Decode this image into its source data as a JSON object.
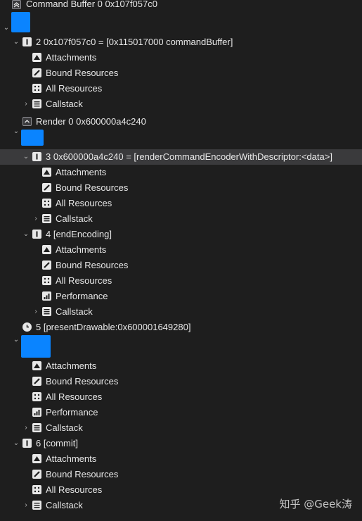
{
  "tree": {
    "command_buffer": "Command Buffer 0 0x107f057c0",
    "cmd2": "2 0x107f057c0 = [0x115017000 commandBuffer]",
    "render": "Render 0 0x600000a4c240",
    "cmd3": "3 0x600000a4c240 = [renderCommandEncoderWithDescriptor:<data>]",
    "cmd4": "4 [endEncoding]",
    "cmd5": "5 [presentDrawable:0x600001649280]",
    "cmd6": "6 [commit]",
    "attachments": "Attachments",
    "bound_resources": "Bound Resources",
    "all_resources": "All Resources",
    "performance": "Performance",
    "callstack": "Callstack"
  },
  "watermark": "知乎 @Geek涛",
  "colors": {
    "background": "#1e1e1e",
    "thumbnail": "#0a84ff",
    "selected_row": "#3a3a3c"
  },
  "icons": [
    "chevron-up-box-icon",
    "info-icon",
    "camera-icon",
    "brush-icon",
    "grid-icon",
    "list-icon",
    "bar-chart-icon",
    "clock-icon"
  ]
}
